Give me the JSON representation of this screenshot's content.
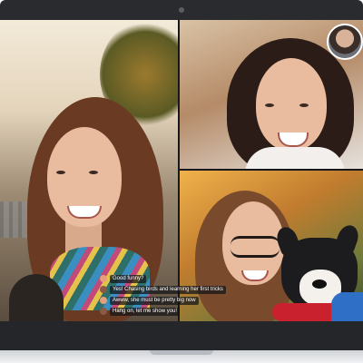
{
  "app": "Video call",
  "participants": [
    {
      "name_icon": "participant-main-woman",
      "tile": "main"
    },
    {
      "name_icon": "participant-top-right-woman",
      "tile": "top-right"
    },
    {
      "name_icon": "participant-bottom-right-woman-with-dog",
      "tile": "bottom-right"
    }
  ],
  "self_view": {
    "icon": "self-view-avatar"
  },
  "captions": [
    {
      "text": "Good funny?",
      "avatar_color": "#e4a07a"
    },
    {
      "text": "Yes! Chasing birds and learning her first tricks",
      "avatar_color": "#8a5a46"
    },
    {
      "text": "Awww, she must be pretty big now",
      "avatar_color": "#e4a07a"
    },
    {
      "text": "Hang on, let me show you!",
      "avatar_color": "#8a5a46"
    }
  ],
  "colors": {
    "device_frame": "#2a2b2f",
    "caption_background": "#141416",
    "caption_text": "#ffffff"
  }
}
